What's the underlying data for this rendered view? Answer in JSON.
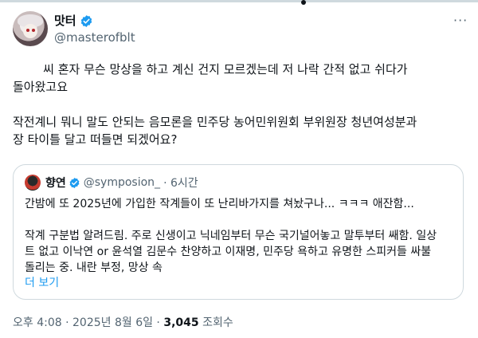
{
  "tweet": {
    "author_name": "맛터",
    "author_handle": "@masterofblt",
    "more_label": "···",
    "body": "        씨 혼자 무슨 망상을 하고 계신 건지 모르겠는데 저 나락 간적 없고 쉬다가\n돌아왔고요\n\n작전계니 뭐니 말도 안되는 음모론을 민주당 농어민위원회 부위원장 청년여성분과\n장 타이틀 달고 떠들면 되겠어요?"
  },
  "quote": {
    "author_name": "향연",
    "author_handle": "@symposion_",
    "time": "· 6시간",
    "text": "간밤에 또 2025년에 가입한 작계들이 또 난리바가지를 쳐놨구나... ㅋㅋㅋ 애잔함...\n\n작계 구분법 알려드림. 주로 신생이고 닉네임부터 무슨 국기널어놓고 말투부터 쌔함. 일상\n트 없고 이낙연 or 윤석열 김문수 찬양하고 이재명, 민주당 욕하고 유명한 스피커들 싸불\n돌리는 중. 내란 부정, 망상 속",
    "show_more": "더 보기"
  },
  "footer": {
    "timestamp": "오후 4:08 · 2025년 8월 6일 · ",
    "views_count": "3,045",
    "views_label": " 조회수"
  },
  "colors": {
    "verified": "#1d9bf0",
    "link": "#1d9bf0",
    "muted": "#536471",
    "border": "#cfd9de"
  }
}
